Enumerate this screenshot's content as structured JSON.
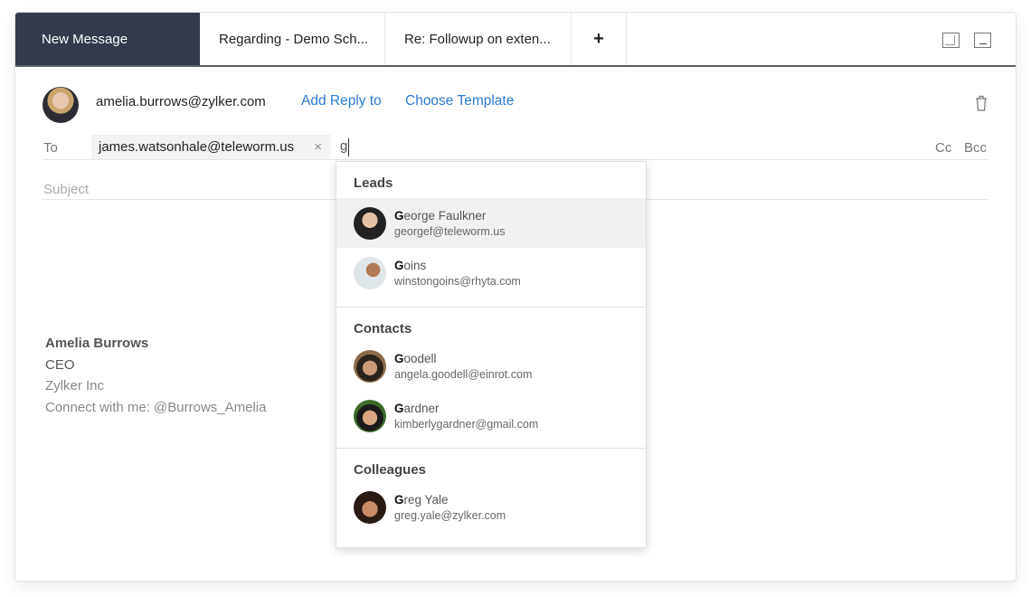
{
  "tabs": [
    {
      "label": "New Message"
    },
    {
      "label": "Regarding - Demo Sch..."
    },
    {
      "label": "Re: Followup on exten..."
    },
    {
      "label": "+"
    }
  ],
  "compose": {
    "from": "amelia.burrows@zylker.com",
    "add_reply_to": "Add Reply to",
    "choose_template": "Choose Template",
    "to_label": "To",
    "recipient_chip": "james.watsonhale@teleworm.us",
    "chip_remove": "×",
    "typed_text": "g",
    "cc": "Cc",
    "bcc": "Bcc",
    "subject_placeholder": "Subject",
    "signature": {
      "name": "Amelia Burrows",
      "title": "CEO",
      "company": "Zylker Inc",
      "social": "Connect with me: @Burrows_Amelia"
    }
  },
  "suggestions": [
    {
      "group": "Leads",
      "items": [
        {
          "match": "G",
          "rest": "eorge Faulkner",
          "email": "georgef@teleworm.us",
          "highlighted": true
        },
        {
          "match": "G",
          "rest": "oins",
          "email": "winstongoins@rhyta.com"
        }
      ]
    },
    {
      "group": "Contacts",
      "items": [
        {
          "match": "G",
          "rest": "oodell",
          "email": "angela.goodell@einrot.com"
        },
        {
          "match": "G",
          "rest": "ardner",
          "email": "kimberlygardner@gmail.com"
        }
      ]
    },
    {
      "group": "Colleagues",
      "items": [
        {
          "match": "G",
          "rest": "reg Yale",
          "email": "greg.yale@zylker.com"
        }
      ]
    }
  ],
  "colors": {
    "active_tab": "#333a4b",
    "link": "#2b7bd3"
  }
}
